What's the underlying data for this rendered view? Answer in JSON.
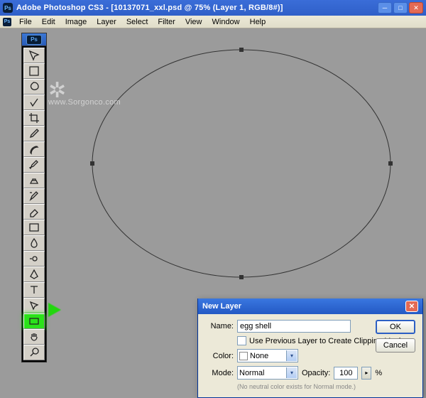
{
  "titlebar": {
    "app": "Adobe Photoshop CS3",
    "doc": "[10137071_xxl.psd @ 75% (Layer 1, RGB/8#)]",
    "ps_short": "Ps"
  },
  "menu": {
    "items": [
      "File",
      "Edit",
      "Image",
      "Layer",
      "Select",
      "Filter",
      "View",
      "Window",
      "Help"
    ]
  },
  "tools": [
    "move-tool",
    "marquee-tool",
    "lasso-tool",
    "quick-select-tool",
    "crop-tool",
    "eyedropper-tool",
    "healing-brush-tool",
    "brush-tool",
    "clone-stamp-tool",
    "history-brush-tool",
    "eraser-tool",
    "gradient-tool",
    "blur-tool",
    "dodge-tool",
    "pen-tool",
    "type-tool",
    "path-select-tool",
    "shape-tool",
    "hand-tool",
    "zoom-tool"
  ],
  "active_tool_index": 17,
  "watermark": {
    "site": "www.Sorgonco.com"
  },
  "dialog": {
    "title": "New Layer",
    "name_label": "Name:",
    "name_value": "egg shell",
    "clip_label": "Use Previous Layer to Create Clipping Mask",
    "color_label": "Color:",
    "color_value": "None",
    "mode_label": "Mode:",
    "mode_value": "Normal",
    "opacity_label": "Opacity:",
    "opacity_value": "100",
    "opacity_unit": "%",
    "ok": "OK",
    "cancel": "Cancel",
    "hint": "(No neutral color exists for Normal mode.)"
  }
}
